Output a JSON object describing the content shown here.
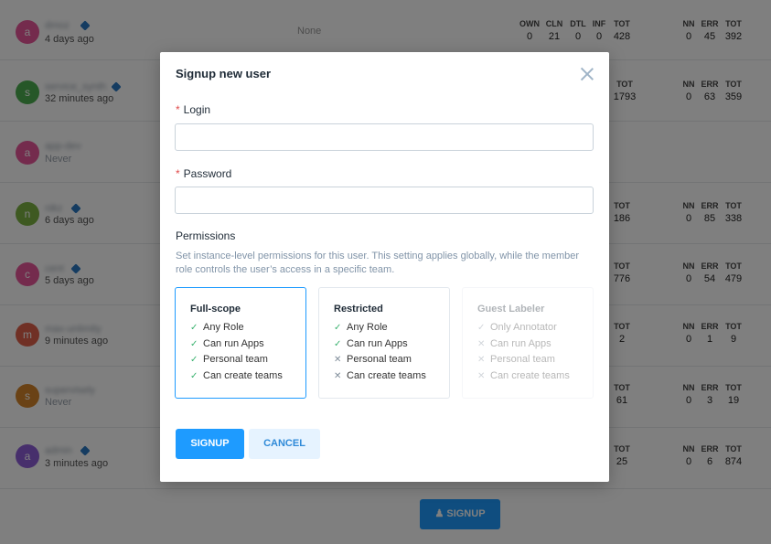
{
  "users": [
    {
      "initial": "a",
      "color": "#e8569a",
      "name": "dmoz",
      "time": "4 days ago",
      "cube": true,
      "stats_left": {
        "headers": [
          "OWN",
          "CLN",
          "DTL",
          "INF",
          "TOT"
        ],
        "values": [
          "0",
          "21",
          "0",
          "0",
          "428"
        ]
      },
      "stats_right": {
        "headers": [
          "NN",
          "ERR",
          "TOT"
        ],
        "values": [
          "0",
          "45",
          "392"
        ]
      },
      "none": "None"
    },
    {
      "initial": "s",
      "color": "#4caf50",
      "name": "service_synth",
      "time": "32 minutes ago",
      "cube": true,
      "tot": {
        "h": "TOT",
        "v": "1793"
      },
      "stats_right": {
        "headers": [
          "NN",
          "ERR",
          "TOT"
        ],
        "values": [
          "0",
          "63",
          "359"
        ]
      }
    },
    {
      "initial": "a",
      "color": "#e8569a",
      "name": "app-dev",
      "time": "Never",
      "cube": false
    },
    {
      "initial": "n",
      "color": "#7cb342",
      "name": "nikz",
      "time": "6 days ago",
      "cube": true,
      "tot": {
        "h": "TOT",
        "v": "186"
      },
      "stats_right": {
        "headers": [
          "NN",
          "ERR",
          "TOT"
        ],
        "values": [
          "0",
          "85",
          "338"
        ]
      }
    },
    {
      "initial": "c",
      "color": "#e8569a",
      "name": "cent",
      "time": "5 days ago",
      "cube": true,
      "tot": {
        "h": "TOT",
        "v": "776"
      },
      "stats_right": {
        "headers": [
          "NN",
          "ERR",
          "TOT"
        ],
        "values": [
          "0",
          "54",
          "479"
        ]
      }
    },
    {
      "initial": "m",
      "color": "#e0604a",
      "name": "max-unlimity",
      "time": "9 minutes ago",
      "cube": false,
      "tot": {
        "h": "TOT",
        "v": "2"
      },
      "stats_right": {
        "headers": [
          "NN",
          "ERR",
          "TOT"
        ],
        "values": [
          "0",
          "1",
          "9"
        ]
      }
    },
    {
      "initial": "s",
      "color": "#d4852a",
      "name": "supervisely",
      "time": "Never",
      "cube": false,
      "tot": {
        "h": "TOT",
        "v": "61"
      },
      "stats_right": {
        "headers": [
          "NN",
          "ERR",
          "TOT"
        ],
        "values": [
          "0",
          "3",
          "19"
        ]
      }
    },
    {
      "initial": "a",
      "color": "#8e5ed8",
      "name": "admin",
      "time": "3 minutes ago",
      "cube": true,
      "tot": {
        "h": "TOT",
        "v": "25"
      },
      "stats_right": {
        "headers": [
          "NN",
          "ERR",
          "TOT"
        ],
        "values": [
          "0",
          "6",
          "874"
        ]
      }
    }
  ],
  "background_signup_label": "SIGNUP",
  "modal": {
    "title": "Signup new user",
    "login_label": "Login",
    "login_value": "",
    "password_label": "Password",
    "password_value": "",
    "required_mark": "*",
    "permissions_heading": "Permissions",
    "permissions_description": "Set instance-level permissions for this user. This setting applies globally, while the member role controls the user’s access in a specific team.",
    "cards": [
      {
        "title": "Full-scope",
        "selected": true,
        "disabled": false,
        "features": [
          {
            "ok": true,
            "text": "Any Role"
          },
          {
            "ok": true,
            "text": "Can run Apps"
          },
          {
            "ok": true,
            "text": "Personal team"
          },
          {
            "ok": true,
            "text": "Can create teams"
          }
        ]
      },
      {
        "title": "Restricted",
        "selected": false,
        "disabled": false,
        "features": [
          {
            "ok": true,
            "text": "Any Role"
          },
          {
            "ok": true,
            "text": "Can run Apps"
          },
          {
            "ok": false,
            "text": "Personal team"
          },
          {
            "ok": false,
            "text": "Can create teams"
          }
        ]
      },
      {
        "title": "Guest Labeler",
        "selected": false,
        "disabled": true,
        "features": [
          {
            "ok": true,
            "text": "Only Annotator"
          },
          {
            "ok": false,
            "text": "Can run Apps"
          },
          {
            "ok": false,
            "text": "Personal team"
          },
          {
            "ok": false,
            "text": "Can create teams"
          }
        ]
      }
    ],
    "signup_label": "SIGNUP",
    "cancel_label": "CANCEL"
  },
  "colors": {
    "accent": "#1e9bff",
    "required": "#e04b4b",
    "check": "#3cb371"
  }
}
